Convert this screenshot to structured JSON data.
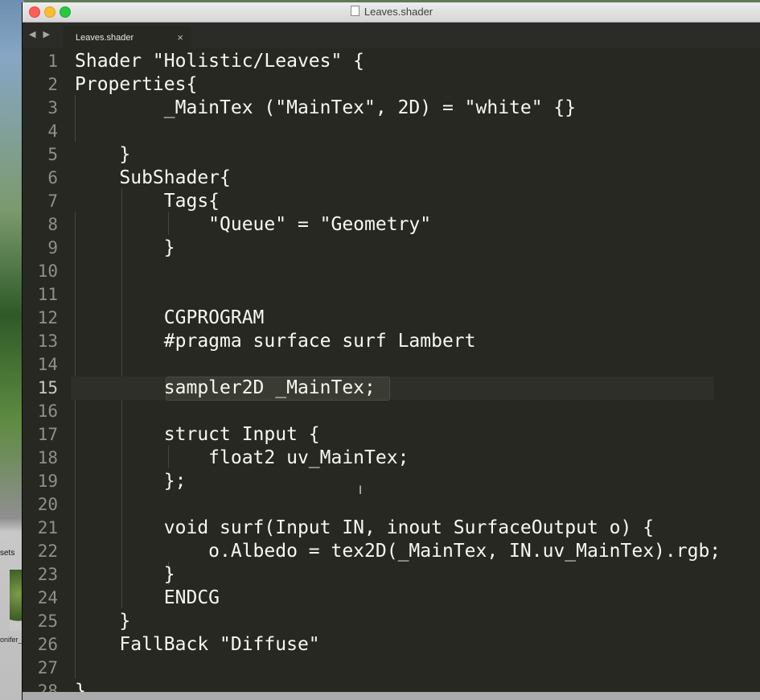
{
  "window": {
    "title": "Leaves.shader"
  },
  "background": {
    "assets_label": "sets",
    "thumb_label": "onifer_"
  },
  "tabbar": {
    "nav": "◀ ▶",
    "tab_label": "Leaves.shader",
    "close_glyph": "×"
  },
  "editor": {
    "active_line": 15,
    "lines": [
      {
        "num": "1",
        "text": "Shader \"Holistic/Leaves\" {"
      },
      {
        "num": "2",
        "text": "Properties{"
      },
      {
        "num": "3",
        "text": "        _MainTex (\"MainTex\", 2D) = \"white\" {}"
      },
      {
        "num": "4",
        "text": ""
      },
      {
        "num": "5",
        "text": "    }"
      },
      {
        "num": "6",
        "text": "    SubShader{"
      },
      {
        "num": "7",
        "text": "        Tags{"
      },
      {
        "num": "8",
        "text": "            \"Queue\" = \"Geometry\""
      },
      {
        "num": "9",
        "text": "        }"
      },
      {
        "num": "10",
        "text": ""
      },
      {
        "num": "11",
        "text": ""
      },
      {
        "num": "12",
        "text": "        CGPROGRAM"
      },
      {
        "num": "13",
        "text": "        #pragma surface surf Lambert"
      },
      {
        "num": "14",
        "text": ""
      },
      {
        "num": "15",
        "text": "        sampler2D _MainTex;"
      },
      {
        "num": "16",
        "text": ""
      },
      {
        "num": "17",
        "text": "        struct Input {"
      },
      {
        "num": "18",
        "text": "            float2 uv_MainTex;"
      },
      {
        "num": "19",
        "text": "        };"
      },
      {
        "num": "20",
        "text": ""
      },
      {
        "num": "21",
        "text": "        void surf(Input IN, inout SurfaceOutput o) {"
      },
      {
        "num": "22",
        "text": "            o.Albedo = tex2D(_MainTex, IN.uv_MainTex).rgb;"
      },
      {
        "num": "23",
        "text": "        }"
      },
      {
        "num": "24",
        "text": "        ENDCG"
      },
      {
        "num": "25",
        "text": "    }"
      },
      {
        "num": "26",
        "text": "    FallBack \"Diffuse\""
      },
      {
        "num": "27",
        "text": ""
      },
      {
        "num": "28",
        "text": "}"
      }
    ]
  }
}
